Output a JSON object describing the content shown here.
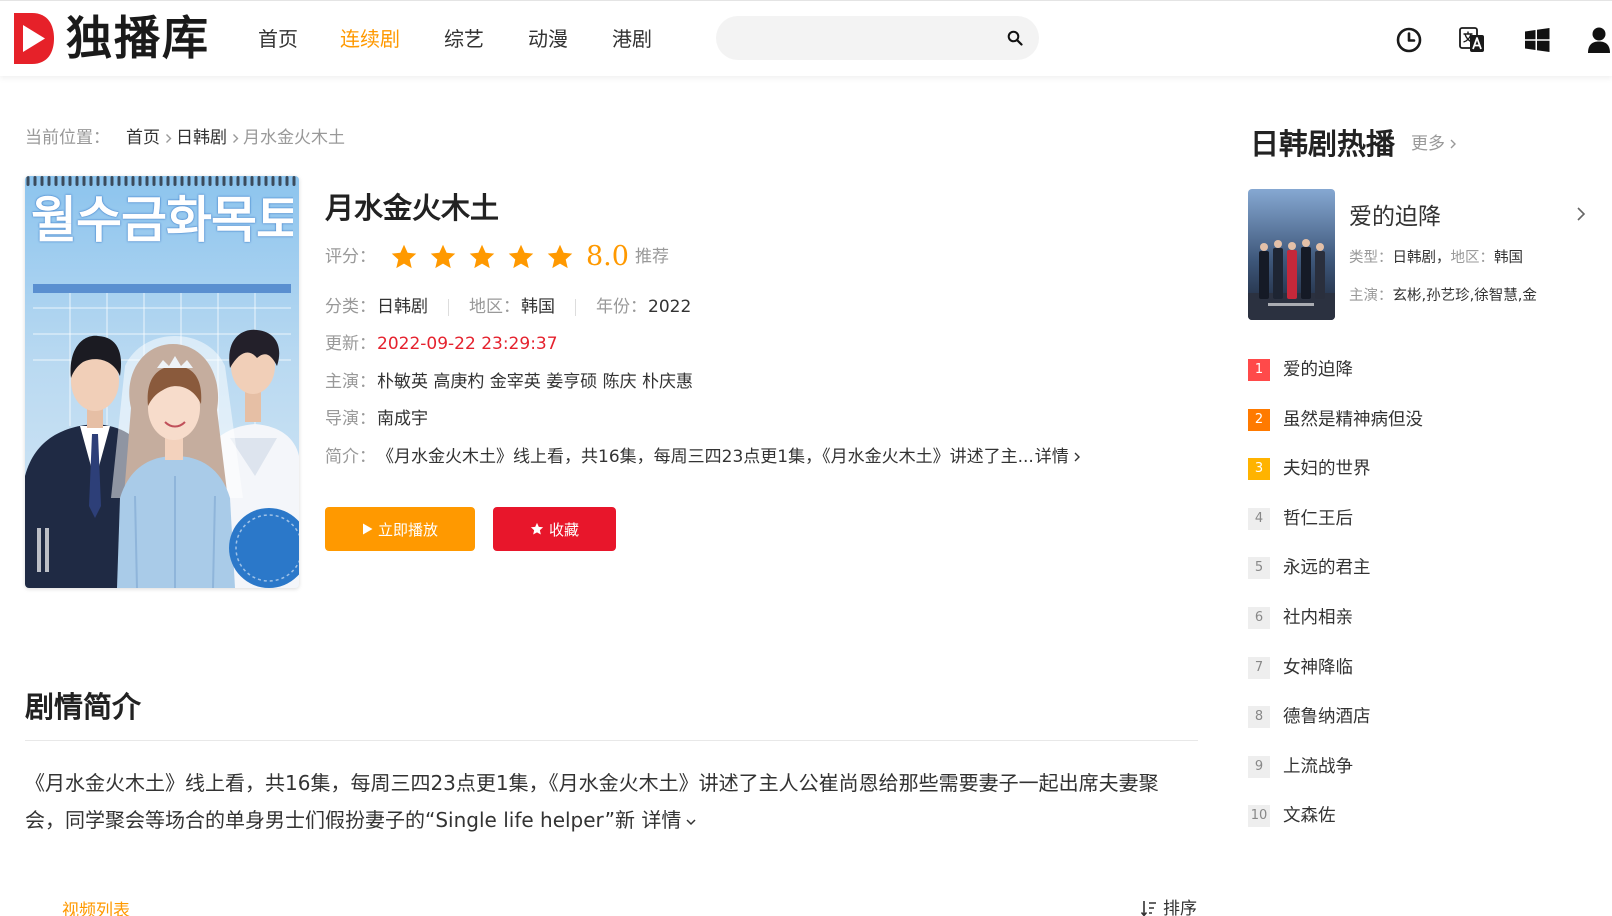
{
  "brand": {
    "name": "独播库"
  },
  "nav": {
    "items": [
      {
        "label": "首页"
      },
      {
        "label": "连续剧",
        "active": true
      },
      {
        "label": "综艺"
      },
      {
        "label": "动漫"
      },
      {
        "label": "港剧"
      }
    ]
  },
  "search": {
    "value": "",
    "icon": "search-icon"
  },
  "header_icons": [
    "clock-icon",
    "translate-icon",
    "windows-icon",
    "user-icon"
  ],
  "breadcrumb": {
    "label": "当前位置：",
    "items": [
      "首页",
      "日韩剧",
      "月水金火木土"
    ]
  },
  "poster": {
    "title_art": "월수금화목토"
  },
  "detail": {
    "title": "月水金火木土",
    "rating": {
      "label": "评分：",
      "stars_filled": 5,
      "stars_max": 5,
      "score": "8.0",
      "recommend": "推荐"
    },
    "category": {
      "label": "分类：",
      "value": "日韩剧"
    },
    "region": {
      "label": "地区：",
      "value": "韩国"
    },
    "year": {
      "label": "年份：",
      "value": "2022"
    },
    "updated": {
      "label": "更新：",
      "value": "2022-09-22 23:29:37"
    },
    "cast": {
      "label": "主演：",
      "value": "朴敏英 高庚杓 金宰英 姜亨硕 陈庆 朴庆惠"
    },
    "director": {
      "label": "导演：",
      "value": "南成宇"
    },
    "intro": {
      "label": "简介：",
      "value": "《月水金火木土》线上看，共16集，每周三四23点更1集，《月水金火木土》讲述了主...",
      "more": "详情"
    }
  },
  "actions": {
    "play": "立即播放",
    "favorite": "收藏"
  },
  "synopsis": {
    "heading": "剧情简介",
    "text": "《月水金火木土》线上看，共16集，每周三四23点更1集，《月水金火木土》讲述了主人公崔尚恩给那些需要妻子一起出席夫妻聚会，同学聚会等场合的单身男士们假扮妻子的“Single life helper”新",
    "more": "详情"
  },
  "episodes": {
    "tab": "视频列表",
    "sort": "排序"
  },
  "sidebar": {
    "title": "日韩剧热播",
    "more": "更多",
    "featured": {
      "title": "爱的迫降",
      "type_label": "类型：",
      "type_value": "日韩剧",
      "sep": "，",
      "region_label": "地区：",
      "region_value": "韩国",
      "cast_label": "主演：",
      "cast_value": "玄彬,孙艺珍,徐智慧,金"
    },
    "ranking": [
      {
        "rank": "1",
        "title": "爱的迫降"
      },
      {
        "rank": "2",
        "title": "虽然是精神病但没"
      },
      {
        "rank": "3",
        "title": "夫妇的世界"
      },
      {
        "rank": "4",
        "title": "哲仁王后"
      },
      {
        "rank": "5",
        "title": "永远的君主"
      },
      {
        "rank": "6",
        "title": "社内相亲"
      },
      {
        "rank": "7",
        "title": "女神降临"
      },
      {
        "rank": "8",
        "title": "德鲁纳酒店"
      },
      {
        "rank": "9",
        "title": "上流战争"
      },
      {
        "rank": "10",
        "title": "文森佐"
      }
    ]
  },
  "colors": {
    "accent": "#ff9900",
    "danger": "#e8162b",
    "date": "#e5222e",
    "rank1": "#ff4a4a",
    "rank2": "#ff7a00",
    "rank3": "#ffb300"
  }
}
